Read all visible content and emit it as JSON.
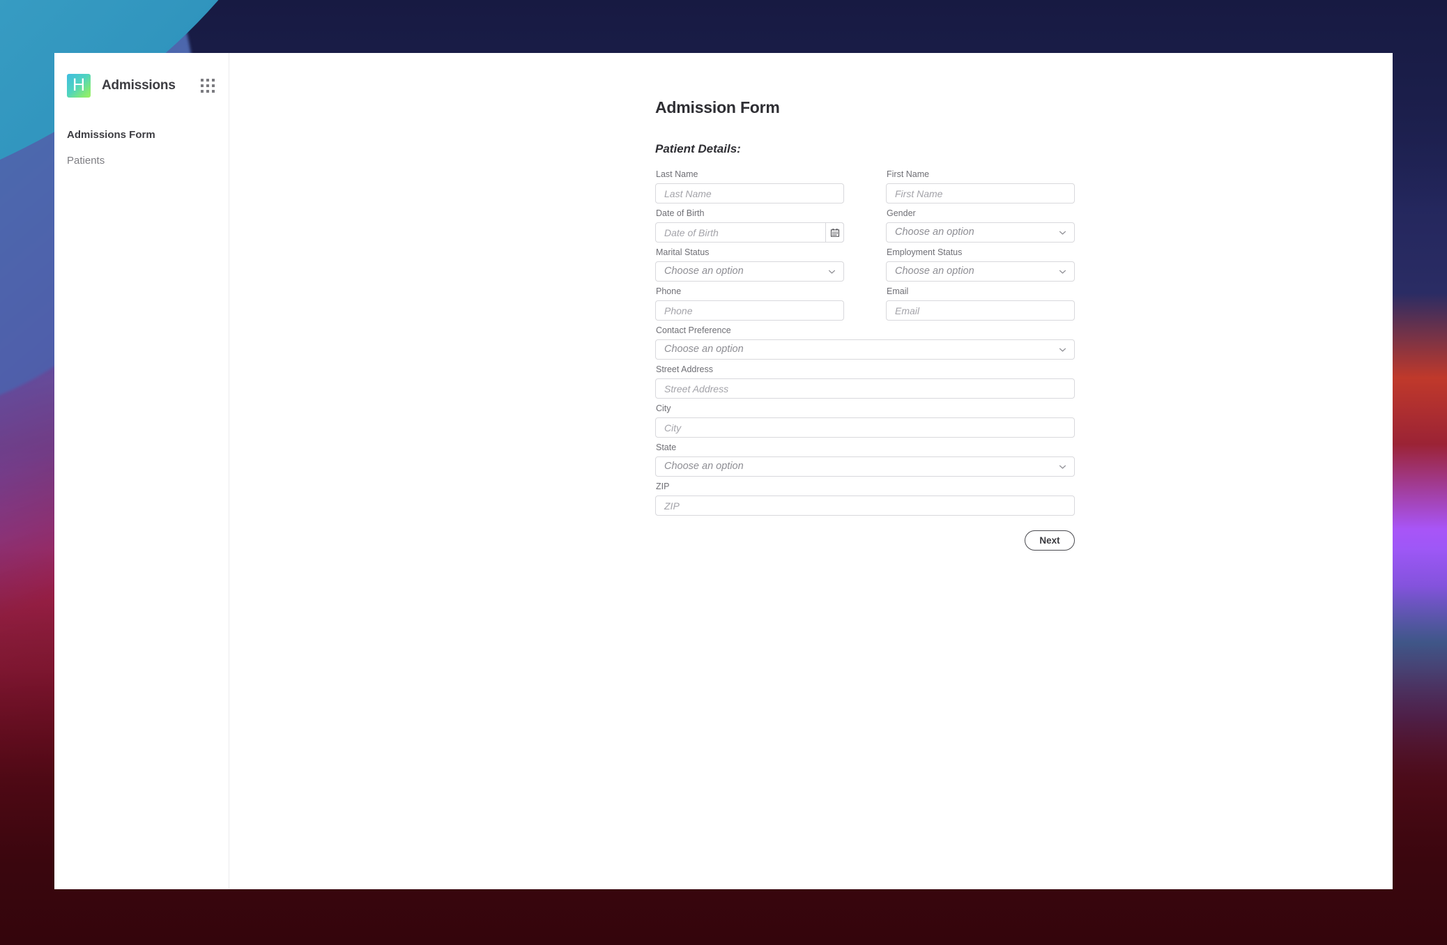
{
  "window": {
    "sidebar": {
      "brand": {
        "logo_letter": "H",
        "title": "Admissions",
        "apps_icon": "grid-apps-icon"
      },
      "items": [
        {
          "label": "Admissions Form",
          "active": true
        },
        {
          "label": "Patients",
          "active": false
        }
      ]
    },
    "main": {
      "page_title": "Admission Form",
      "section_title": "Patient Details:",
      "fields": {
        "last_name": {
          "label": "Last Name",
          "placeholder": "Last Name",
          "value": "",
          "type": "text"
        },
        "first_name": {
          "label": "First Name",
          "placeholder": "First Name",
          "value": "",
          "type": "text"
        },
        "date_of_birth": {
          "label": "Date of Birth",
          "placeholder": "Date of Birth",
          "value": "",
          "type": "date"
        },
        "gender": {
          "label": "Gender",
          "placeholder": "Choose an option",
          "value": "",
          "type": "select"
        },
        "marital_status": {
          "label": "Marital Status",
          "placeholder": "Choose an option",
          "value": "",
          "type": "select"
        },
        "employment_status": {
          "label": "Employment Status",
          "placeholder": "Choose an option",
          "value": "",
          "type": "select"
        },
        "phone": {
          "label": "Phone",
          "placeholder": "Phone",
          "value": "",
          "type": "text"
        },
        "email": {
          "label": "Email",
          "placeholder": "Email",
          "value": "",
          "type": "text"
        },
        "contact_pref": {
          "label": "Contact Preference",
          "placeholder": "Choose an option",
          "value": "",
          "type": "select"
        },
        "street_address": {
          "label": "Street Address",
          "placeholder": "Street Address",
          "value": "",
          "type": "text"
        },
        "city": {
          "label": "City",
          "placeholder": "City",
          "value": "",
          "type": "text"
        },
        "state": {
          "label": "State",
          "placeholder": "Choose an option",
          "value": "",
          "type": "select"
        },
        "zip": {
          "label": "ZIP",
          "placeholder": "ZIP",
          "value": "",
          "type": "text"
        }
      },
      "next_button": "Next"
    }
  },
  "colors": {
    "logo_gradient_start": "#3fbce0",
    "logo_gradient_end": "#9df15f",
    "text_primary": "#2f2f34",
    "text_muted": "#7d7d82",
    "field_border": "#d8d8dc",
    "placeholder": "#a3a3a9",
    "button_border": "#4b4b50"
  }
}
